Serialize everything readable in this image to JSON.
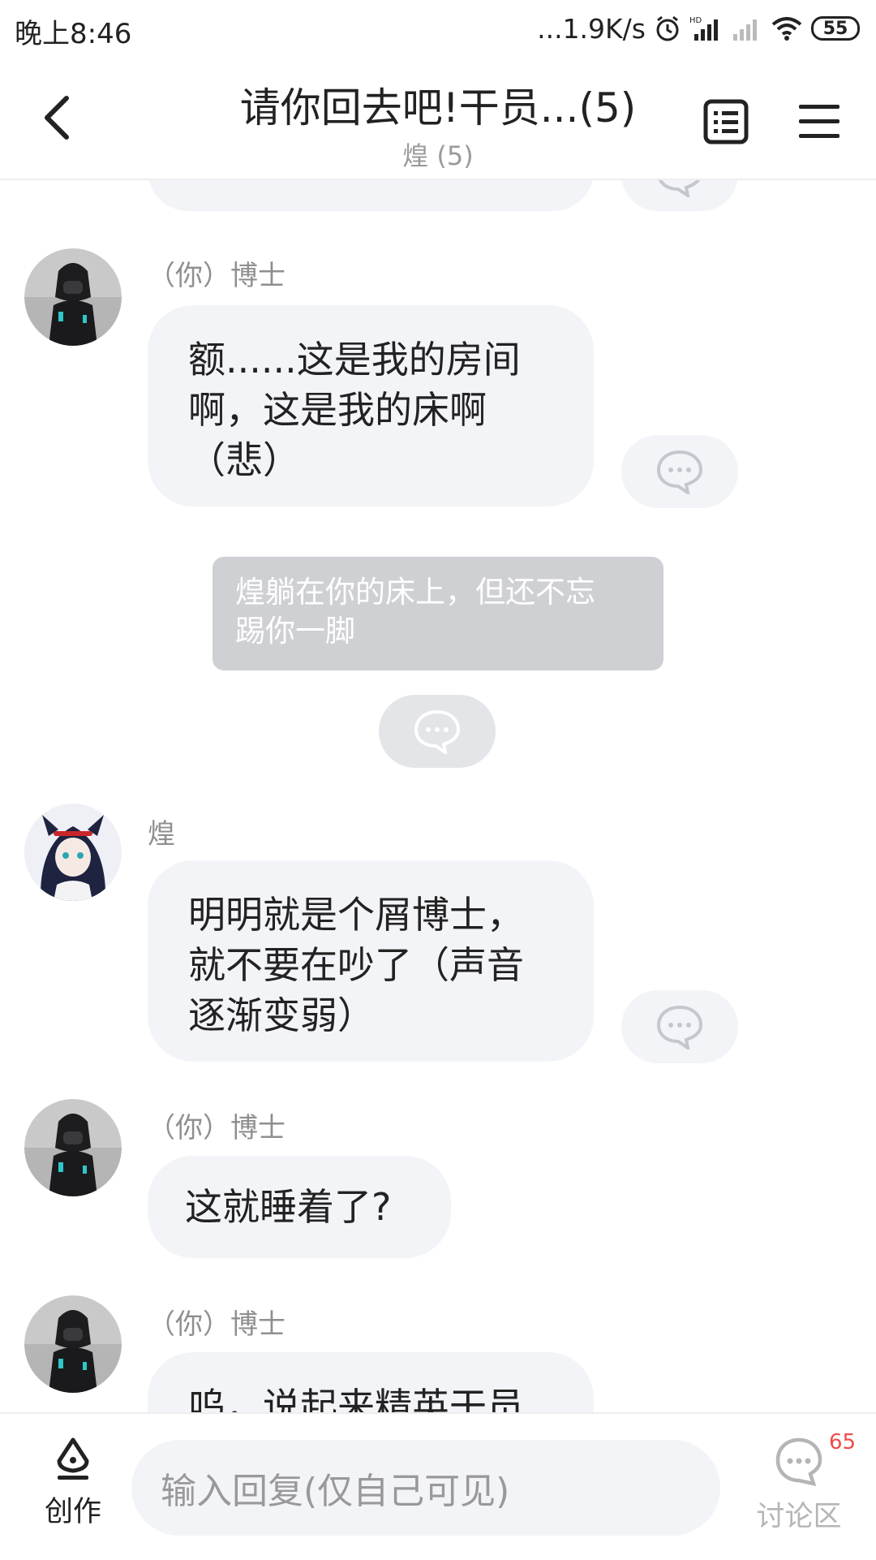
{
  "status_bar": {
    "time": "晚上8:46",
    "net_speed": "...1.9K/s",
    "battery": "55"
  },
  "header": {
    "title": "请你回去吧!干员...(5)",
    "subtitle": "煌 (5)"
  },
  "messages": [
    {
      "sender": "（你）博士",
      "text_lines": [
        "额......这是我的房间",
        "啊，这是我的床啊",
        "（悲）"
      ]
    },
    {
      "narration_lines": [
        "煌躺在你的床上，但还不忘",
        "踢你一脚"
      ]
    },
    {
      "sender": "煌",
      "text_lines": [
        "明明就是个屑博士，",
        "就不要在吵了（声音",
        "逐渐变弱）"
      ]
    },
    {
      "sender": "（你）博士",
      "text_lines": [
        "这就睡着了?"
      ]
    },
    {
      "sender": "（你）博士",
      "text_lines": [
        "呜，说起来精英干员"
      ]
    }
  ],
  "bottom_bar": {
    "create_label": "创作",
    "input_placeholder": "输入回复(仅自己可见)",
    "discuss_label": "讨论区",
    "discuss_badge": "65"
  },
  "colors": {
    "bubble": "#f3f4f7",
    "narration": "#cfd0d3",
    "badge": "#f04a4a",
    "muted_text": "#8f8f8f"
  }
}
